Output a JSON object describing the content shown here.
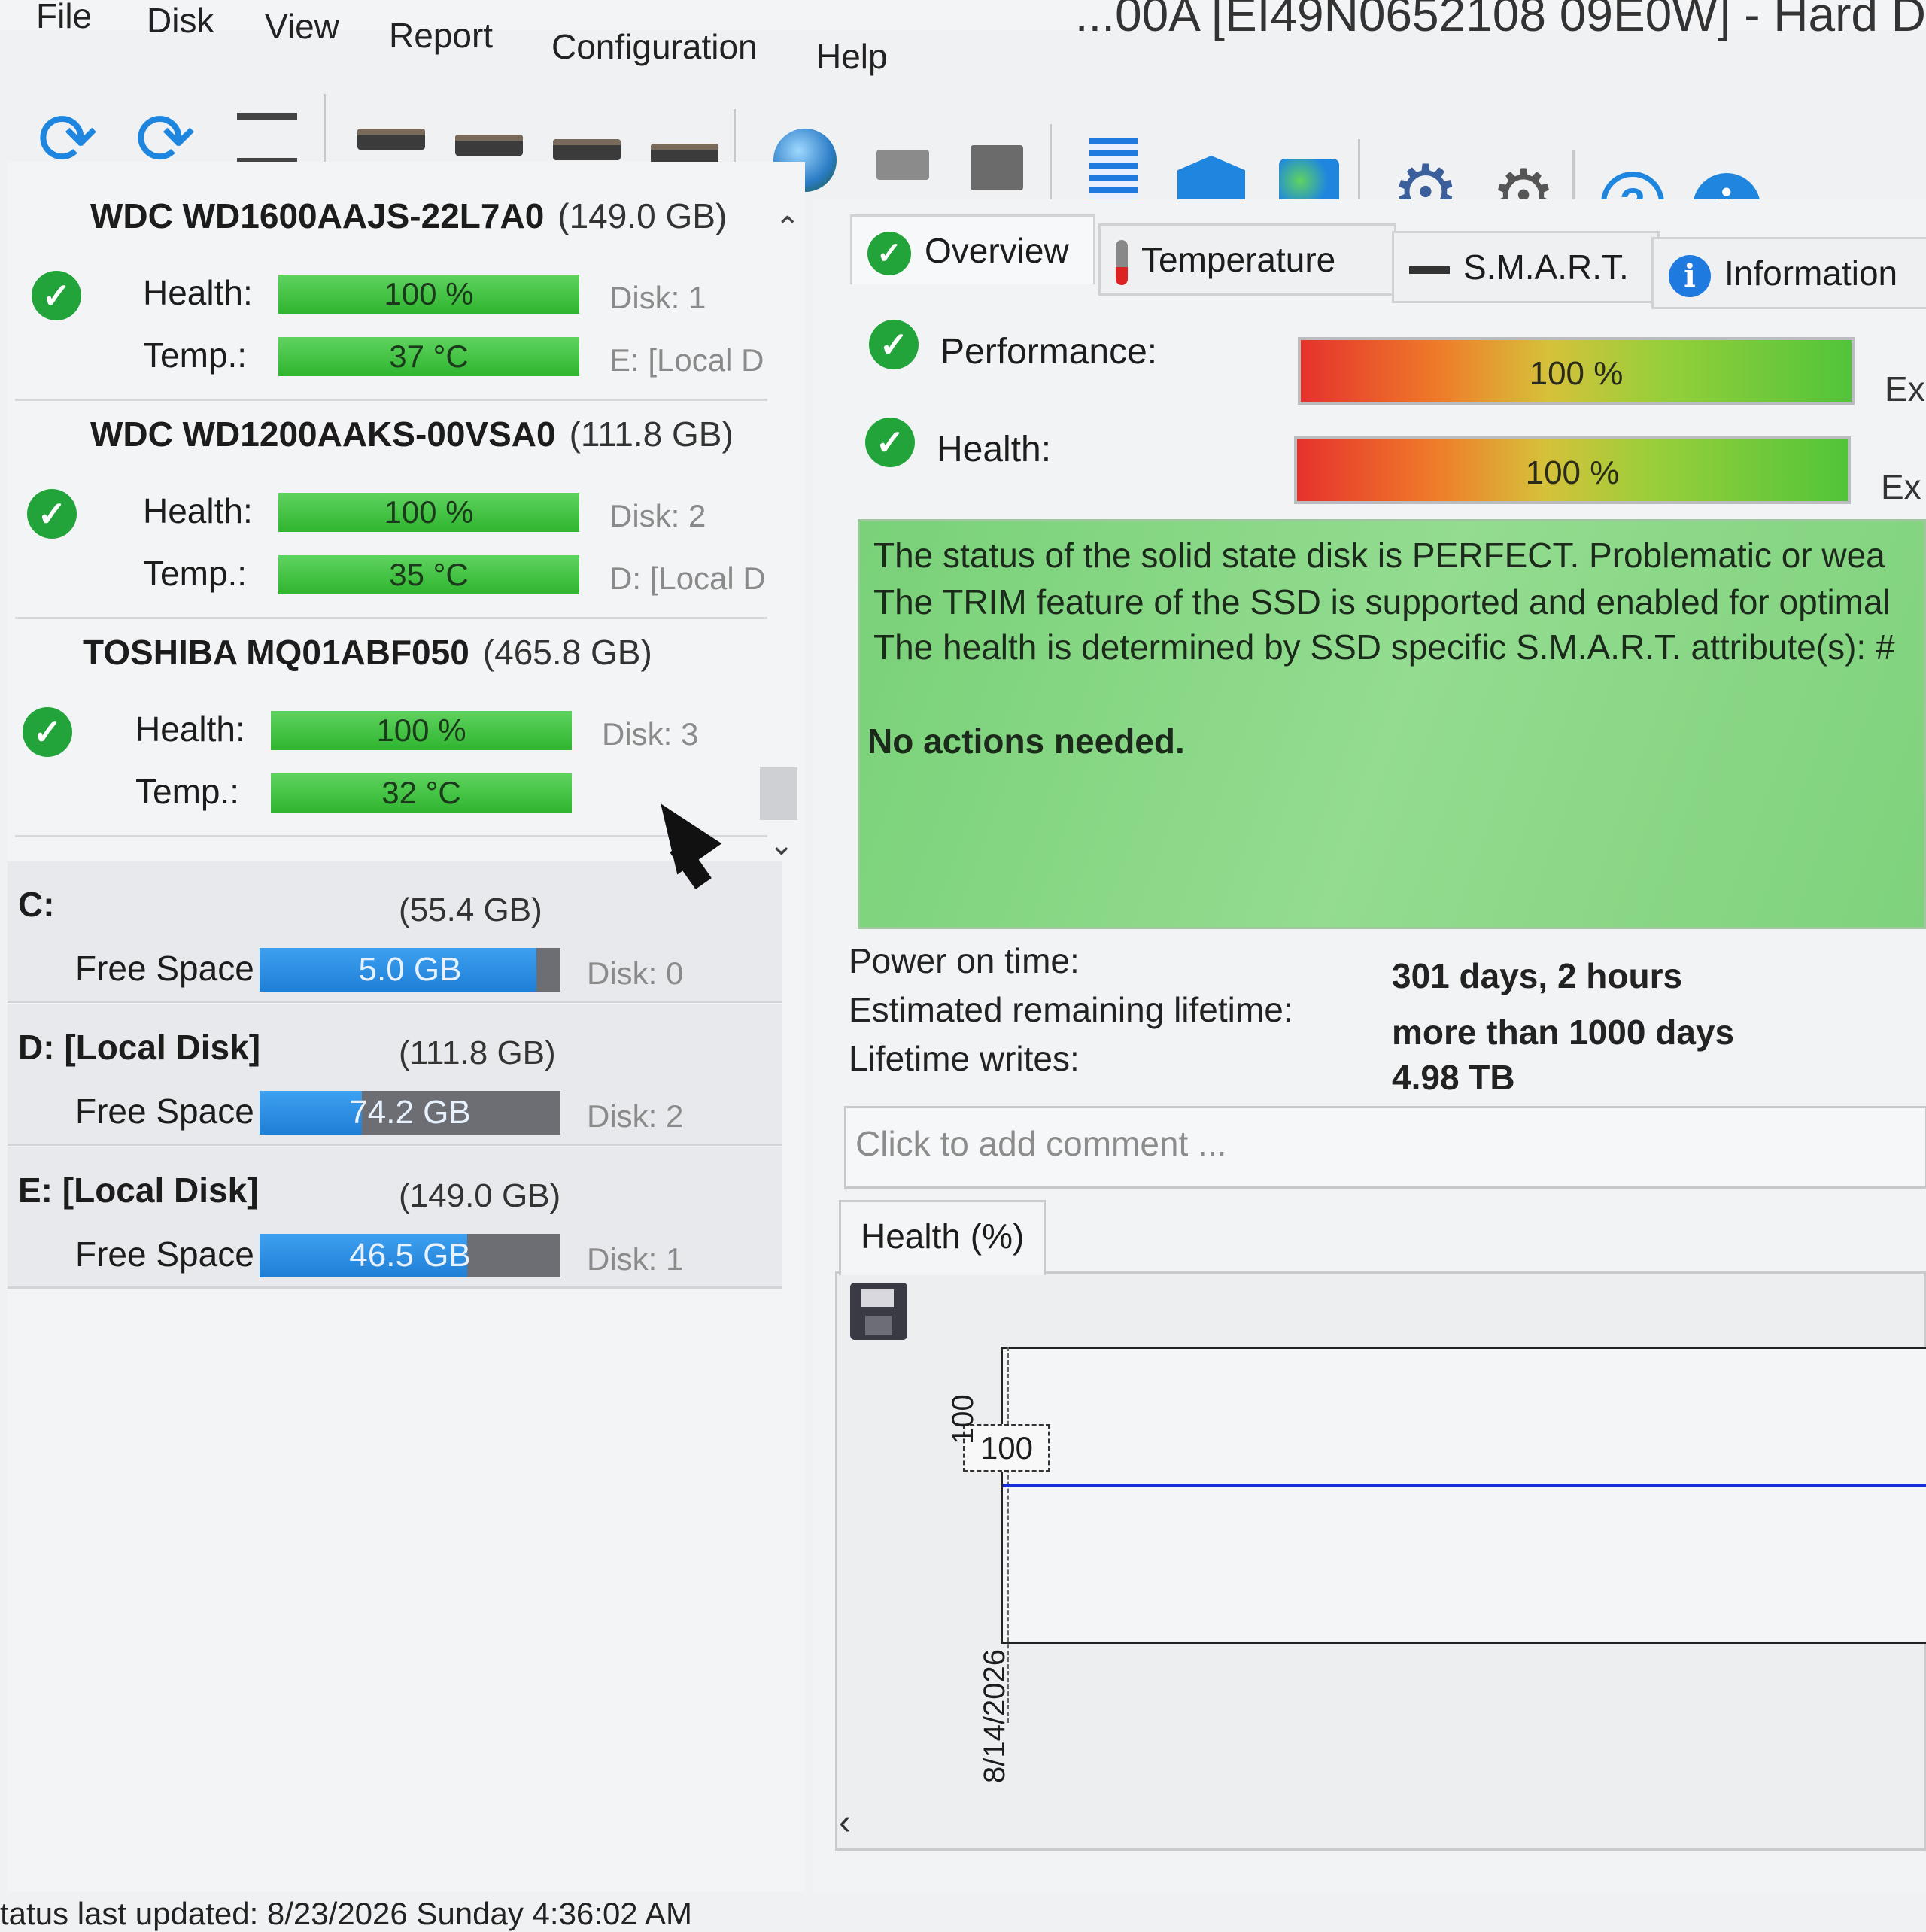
{
  "window_title": "...00A [EI49N0652108 09E0W] - Hard D",
  "menu": [
    "File",
    "Disk",
    "View",
    "Report",
    "Configuration",
    "Help"
  ],
  "toolbar_icons": [
    "refresh-icon",
    "refresh-warning-icon",
    "disk-list-icon",
    "disk-tools-icon",
    "disk-schedule-icon",
    "disk-check-icon",
    "disk-search-icon",
    "globe-disk-icon",
    "network-icon",
    "copy-disk-icon",
    "report-icon",
    "email-icon",
    "web-icon",
    "settings-icon",
    "alert-settings-icon",
    "help-icon",
    "info-icon"
  ],
  "disks": [
    {
      "name": "WDC WD1600AAJS-22L7A0",
      "size": "(149.0 GB)",
      "health_label": "Health:",
      "health": "100 %",
      "temp_label": "Temp.:",
      "temp": "37 °C",
      "disk": "Disk: 1",
      "volume": "E: [Local D"
    },
    {
      "name": "WDC WD1200AAKS-00VSA0",
      "size": "(111.8 GB)",
      "health_label": "Health:",
      "health": "100 %",
      "temp_label": "Temp.:",
      "temp": "35 °C",
      "disk": "Disk: 2",
      "volume": "D: [Local D"
    },
    {
      "name": "TOSHIBA MQ01ABF050",
      "size": "(465.8 GB)",
      "health_label": "Health:",
      "health": "100 %",
      "temp_label": "Temp.:",
      "temp": "32 °C",
      "disk": "Disk: 3",
      "volume": ""
    }
  ],
  "volumes": [
    {
      "name": "C:",
      "size": "(55.4 GB)",
      "label": "Free Space",
      "free": "5.0 GB",
      "fill": 0.92,
      "disk": "Disk: 0"
    },
    {
      "name": "D: [Local Disk]",
      "size": "(111.8 GB)",
      "label": "Free Space",
      "free": "74.2 GB",
      "fill": 0.34,
      "disk": "Disk: 2"
    },
    {
      "name": "E: [Local Disk]",
      "size": "(149.0 GB)",
      "label": "Free Space",
      "free": "46.5 GB",
      "fill": 0.69,
      "disk": "Disk: 1"
    }
  ],
  "tabs": [
    "Overview",
    "Temperature",
    "S.M.A.R.T.",
    "Information"
  ],
  "performance": {
    "label": "Performance:",
    "value": "100 %",
    "rating": "Ex"
  },
  "health": {
    "label": "Health:",
    "value": "100 %",
    "rating": "Ex"
  },
  "status_lines": [
    "The status of the solid state disk is PERFECT. Problematic or wea",
    "The TRIM feature of the SSD is supported and enabled for optimal",
    "The health is determined by SSD specific S.M.A.R.T. attribute(s): #"
  ],
  "status_action": "No actions needed.",
  "info": [
    {
      "label": "Power on time:",
      "value": "301 days, 2 hours"
    },
    {
      "label": "Estimated remaining lifetime:",
      "value": "more than 1000 days"
    },
    {
      "label": "Lifetime writes:",
      "value": "4.98 TB"
    }
  ],
  "comment_placeholder": "Click to add comment ...",
  "chart_tab": "Health (%)",
  "chart_data": {
    "type": "line",
    "x": [
      "8/14/2026"
    ],
    "series": [
      {
        "values": [
          100
        ]
      }
    ],
    "point_label": "100",
    "y_tick": "100",
    "x_tick": "8/14/2026"
  },
  "status_bar": "tatus last updated: 8/23/2026 Sunday 4:36:02 AM"
}
